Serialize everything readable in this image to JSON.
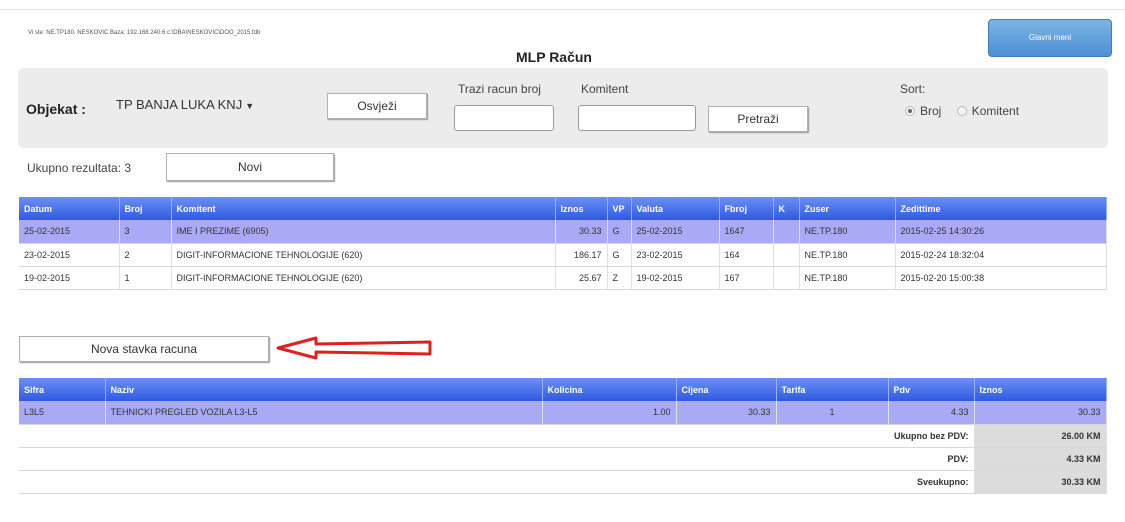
{
  "header": {
    "info": "Vi ste: NE.TP180. NESKOVIC Baza: 192.168.240.6 c:\\DBA\\NESKOVIC\\DOO_2015.fdb",
    "title": "MLP Račun",
    "glavni_meni": "Glavni meni"
  },
  "filter": {
    "objekat_label": "Objekat :",
    "objekat_value": "TP BANJA LUKA KNJ",
    "osvjezi": "Osvježi",
    "trazi_label": "Trazi racun broj",
    "trazi_value": "",
    "komitent_label": "Komitent",
    "komitent_value": "",
    "pretrazi": "Pretraži",
    "sort_label": "Sort:",
    "sort_options": [
      "Broj",
      "Komitent"
    ],
    "sort_selected": "Broj"
  },
  "results": {
    "ukupno": "Ukupno rezultata: 3",
    "novi": "Novi"
  },
  "invoices": {
    "columns": [
      "Datum",
      "Broj",
      "Komitent",
      "Iznos",
      "VP",
      "Valuta",
      "Fbroj",
      "K",
      "Zuser",
      "Zedittime"
    ],
    "rows": [
      [
        "25-02-2015",
        "3",
        "IME I PREZIME (6905)",
        "30.33",
        "G",
        "25-02-2015",
        "1647",
        "",
        "NE.TP.180",
        "2015-02-25 14:30:26"
      ],
      [
        "23-02-2015",
        "2",
        "DIGIT-INFORMACIONE TEHNOLOGIJE (620)",
        "186.17",
        "G",
        "23-02-2015",
        "164",
        "",
        "NE.TP.180",
        "2015-02-24 18:32:04"
      ],
      [
        "19-02-2015",
        "1",
        "DIGIT-INFORMACIONE TEHNOLOGIJE (620)",
        "25.67",
        "Z",
        "19-02-2015",
        "167",
        "",
        "NE.TP.180",
        "2015-02-20 15:00:38"
      ]
    ]
  },
  "nova_stavka": "Nova stavka racuna",
  "items": {
    "columns": [
      "Sifra",
      "Naziv",
      "Kolicina",
      "Cijena",
      "Tarifa",
      "Pdv",
      "Iznos"
    ],
    "rows": [
      [
        "L3L5",
        "TEHNICKI PREGLED VOZILA L3-L5",
        "1.00",
        "30.33",
        "1",
        "4.33",
        "30.33"
      ]
    ],
    "totals": [
      {
        "label": "Ukupno bez PDV:",
        "value": "26.00 KM"
      },
      {
        "label": "PDV:",
        "value": "4.33 KM"
      },
      {
        "label": "Sveukupno:",
        "value": "30.33 KM"
      }
    ]
  },
  "colors": {
    "header_blue": "#2d5ae0",
    "selected_row": "#a9a9f5",
    "button_blue": "#4f90d4",
    "arrow_red": "#e0201c"
  }
}
